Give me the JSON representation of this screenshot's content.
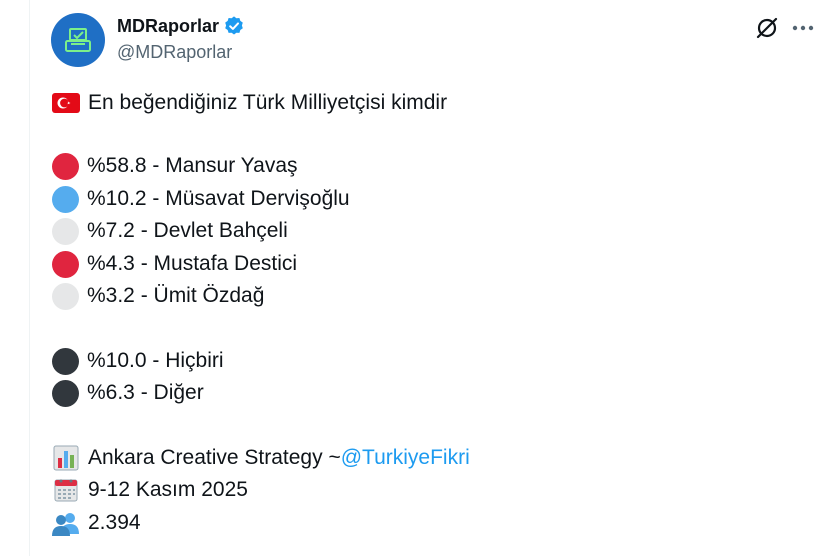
{
  "author": {
    "display_name": "MDRaporlar",
    "handle": "@MDRaporlar",
    "verified": true,
    "avatar_color": "#1f6fc5"
  },
  "header_icons": [
    "grok-icon",
    "more-icon"
  ],
  "tweet": {
    "title_flag": "turkey-flag-icon",
    "title": "En beğendiğiniz Türk Milliyetçisi kimdir",
    "results": [
      {
        "dot_color": "#e0253f",
        "text": "%58.8 - Mansur Yavaş"
      },
      {
        "dot_color": "#55acee",
        "text": "%10.2 - Müsavat Dervişoğlu"
      },
      {
        "dot_color": "#e6e7e8",
        "text": "%7.2 - Devlet Bahçeli"
      },
      {
        "dot_color": "#e0253f",
        "text": "%4.3 - Mustafa Destici"
      },
      {
        "dot_color": "#e6e7e8",
        "text": "%3.2 - Ümit Özdağ"
      }
    ],
    "others": [
      {
        "dot_color": "#31373d",
        "text": "%10.0 - Hiçbiri"
      },
      {
        "dot_color": "#31373d",
        "text": "%6.3 - Diğer"
      }
    ],
    "source_icon": "bar-chart-icon",
    "source_text": "Ankara Creative Strategy ~ ",
    "source_mention": "@TurkiyeFikri",
    "date_icon": "calendar-icon",
    "date_text": "9-12 Kasım 2025",
    "sample_icon": "people-icon",
    "sample_text": "2.394"
  }
}
